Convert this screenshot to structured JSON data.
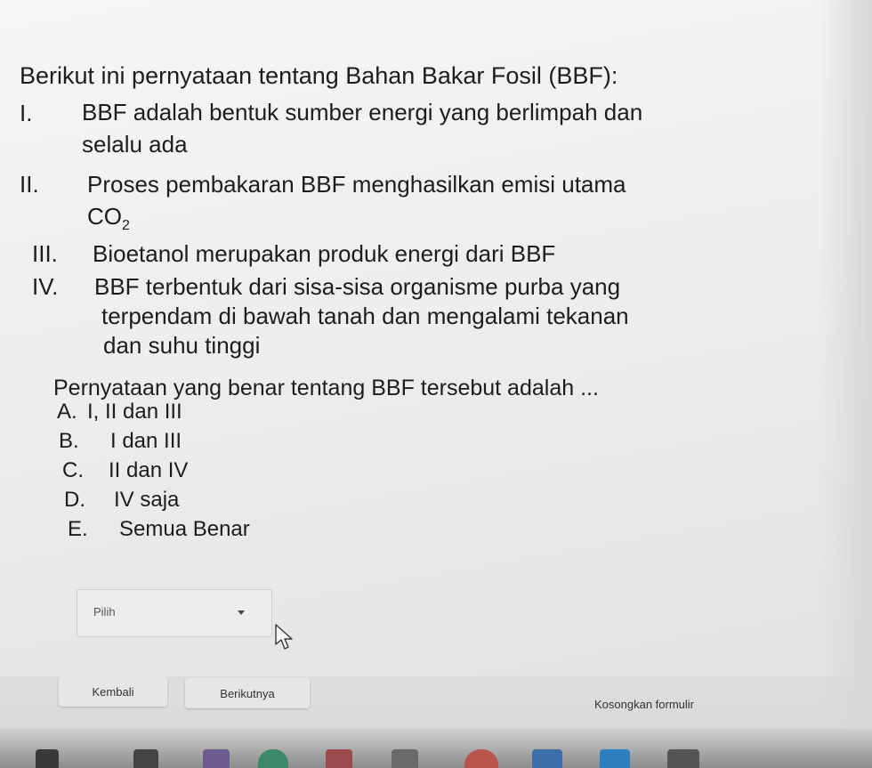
{
  "question": {
    "intro": "Berikut ini pernyataan tentang Bahan Bakar Fosil (BBF):",
    "statements": [
      {
        "num": "I.",
        "lines": [
          "BBF adalah bentuk sumber energi yang berlimpah dan",
          "selalu ada"
        ]
      },
      {
        "num": "II.",
        "line1": "Proses pembakaran BBF menghasilkan emisi utama",
        "formula_main": "CO",
        "formula_sub": "2"
      },
      {
        "num": "III.",
        "lines": [
          "Bioetanol merupakan produk energi dari BBF"
        ]
      },
      {
        "num": "IV.",
        "lines": [
          "BBF terbentuk dari sisa-sisa organisme purba yang",
          "terpendam di bawah tanah dan mengalami tekanan",
          "dan suhu tinggi"
        ]
      }
    ],
    "prompt": "Pernyataan yang benar tentang BBF tersebut adalah ...",
    "options": [
      {
        "letter": "A.",
        "text": "I, II dan III"
      },
      {
        "letter": "B.",
        "text": "I dan III"
      },
      {
        "letter": "C.",
        "text": "II dan IV"
      },
      {
        "letter": "D.",
        "text": "IV saja"
      },
      {
        "letter": "E.",
        "text": "Semua Benar"
      }
    ]
  },
  "answer_select": {
    "placeholder": "Pilih"
  },
  "footer": {
    "back_label": "Kembali",
    "next_label": "Berikutnya",
    "clear_label": "Kosongkan formulir"
  },
  "colors": {
    "text": "#1d1d1d",
    "background": "#ececec",
    "button": "#e6e6e6"
  },
  "icons": {
    "dropdown": "chevron-down-icon",
    "pointer": "mouse-cursor-icon"
  }
}
